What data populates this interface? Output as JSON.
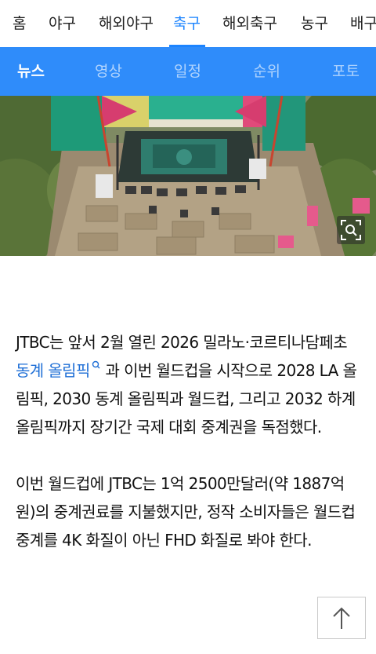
{
  "category_nav": {
    "items": [
      {
        "label": "홈",
        "active": false
      },
      {
        "label": "야구",
        "active": false
      },
      {
        "label": "해외야구",
        "active": false
      },
      {
        "label": "축구",
        "active": true
      },
      {
        "label": "해외축구",
        "active": false
      },
      {
        "label": "농구",
        "active": false
      },
      {
        "label": "배구",
        "active": false
      }
    ]
  },
  "sub_nav": {
    "items": [
      {
        "label": "뉴스",
        "active": true
      },
      {
        "label": "영상",
        "active": false
      },
      {
        "label": "일정",
        "active": false
      },
      {
        "label": "순위",
        "active": false
      },
      {
        "label": "포토",
        "active": false
      }
    ]
  },
  "photo": {
    "zoom_icon": "zoom-icon"
  },
  "article": {
    "p1_before": "JTBC는 앞서 2월 열린 2026 밀라노·코르티나담페초 ",
    "p1_link": "동계 올림픽",
    "p1_after": " 과 이번 월드컵을 시작으로 2028 LA 올림픽, 2030 동계 올림픽과 월드컵, 그리고 2032 하계 올림픽까지 장기간 국제 대회 중계권을 독점했다.",
    "p2": "이번 월드컵에 JTBC는 1억 2500만달러(약 1887억원)의 중계권료를 지불했지만, 정작 소비자들은 월드컵 중계를 4K 화질이 아닌 FHD 화질로 봐야 한다."
  },
  "scroll_top_icon": "arrow-up-icon",
  "colors": {
    "accent": "#1c84ff",
    "sub_nav_bg": "#2f8cfa",
    "link": "#1f6fd6"
  }
}
